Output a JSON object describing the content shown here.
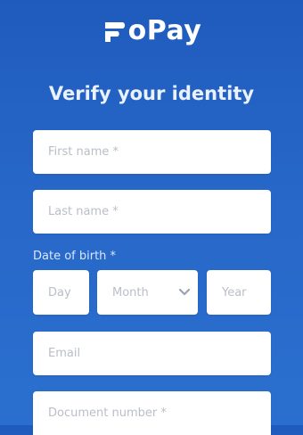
{
  "brand": {
    "name": "oPay",
    "logo_icon": "fopay-f-mark-icon",
    "text_color": "#ffffff"
  },
  "title": "Verify your identity",
  "colors": {
    "background_top": "#1f5bbd",
    "background_bottom": "#2a6fcf",
    "field_background": "#ffffff",
    "placeholder": "#b9bec7"
  },
  "form": {
    "first_name": {
      "placeholder": "First name *"
    },
    "last_name": {
      "placeholder": "Last name *"
    },
    "date_of_birth": {
      "label": "Date of birth *",
      "day": {
        "placeholder": "Day"
      },
      "month": {
        "placeholder": "Month",
        "icon": "chevron-down-icon"
      },
      "year": {
        "placeholder": "Year"
      }
    },
    "email": {
      "placeholder": "Email"
    },
    "document_number": {
      "placeholder": "Document number *"
    }
  }
}
